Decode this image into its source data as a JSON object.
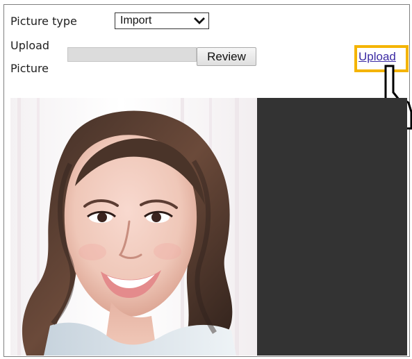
{
  "form": {
    "picture_type_label": "Picture type",
    "picture_type_value": "Import",
    "upload_label_line1": "Upload",
    "upload_label_line2": "Picture",
    "file_input_value": "",
    "review_button_label": "Review",
    "upload_link_label": "Upload"
  },
  "colors": {
    "highlight": "#f4b400",
    "link": "#3b2aa3",
    "preview_background": "#333333"
  },
  "icons": {
    "select_arrow": "chevron-down-icon",
    "cursor": "hand-pointer-cursor"
  }
}
